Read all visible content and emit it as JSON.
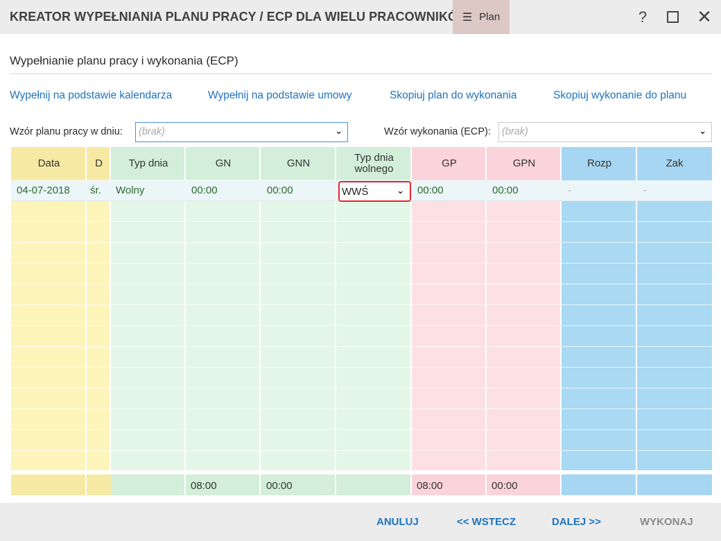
{
  "window": {
    "title": "KREATOR WYPEŁNIANIA PLANU PRACY / ECP DLA WIELU PRACOWNIKÓW",
    "plan_label": "Plan",
    "help_label": "?",
    "close_label": "✕"
  },
  "section": {
    "title": "Wypełnianie planu pracy i wykonania (ECP)"
  },
  "links": {
    "fill_calendar": "Wypełnij na podstawie kalendarza",
    "fill_contract": "Wypełnij na podstawie umowy",
    "copy_plan": "Skopiuj plan do wykonania",
    "copy_exec": "Skopiuj wykonanie do planu"
  },
  "filters": {
    "plan_label": "Wzór planu pracy w dniu:",
    "plan_value": "(brak)",
    "exec_label": "Wzór wykonania (ECP):",
    "exec_value": "(brak)"
  },
  "table": {
    "headers": {
      "data": "Data",
      "d": "D",
      "typ_dnia": "Typ dnia",
      "gn": "GN",
      "gnn": "GNN",
      "typ_dnia_wolnego_1": "Typ dnia",
      "typ_dnia_wolnego_2": "wolnego",
      "gp": "GP",
      "gpn": "GPN",
      "rozp": "Rozp",
      "zak": "Zak"
    },
    "row": {
      "data": "04-07-2018",
      "d": "śr.",
      "typ_dnia": "Wolny",
      "gn": "00:00",
      "gnn": "00:00",
      "typ_dnia_wolnego": "WWŚ",
      "gp": "00:00",
      "gpn": "00:00",
      "rozp": "-",
      "zak": "-"
    },
    "summary": {
      "gn": "08:00",
      "gnn": "00:00",
      "gp": "08:00",
      "gpn": "00:00"
    }
  },
  "footer": {
    "cancel": "ANULUJ",
    "back": "<< WSTECZ",
    "next": "DALEJ >>",
    "execute": "WYKONAJ"
  },
  "colors": {
    "accent_link": "#1e73be",
    "highlight_border": "#e0282e",
    "yellow": "#fcf4b9",
    "green": "#e4f6e8",
    "pink": "#fde0e4",
    "blue": "#a9d9f3"
  }
}
